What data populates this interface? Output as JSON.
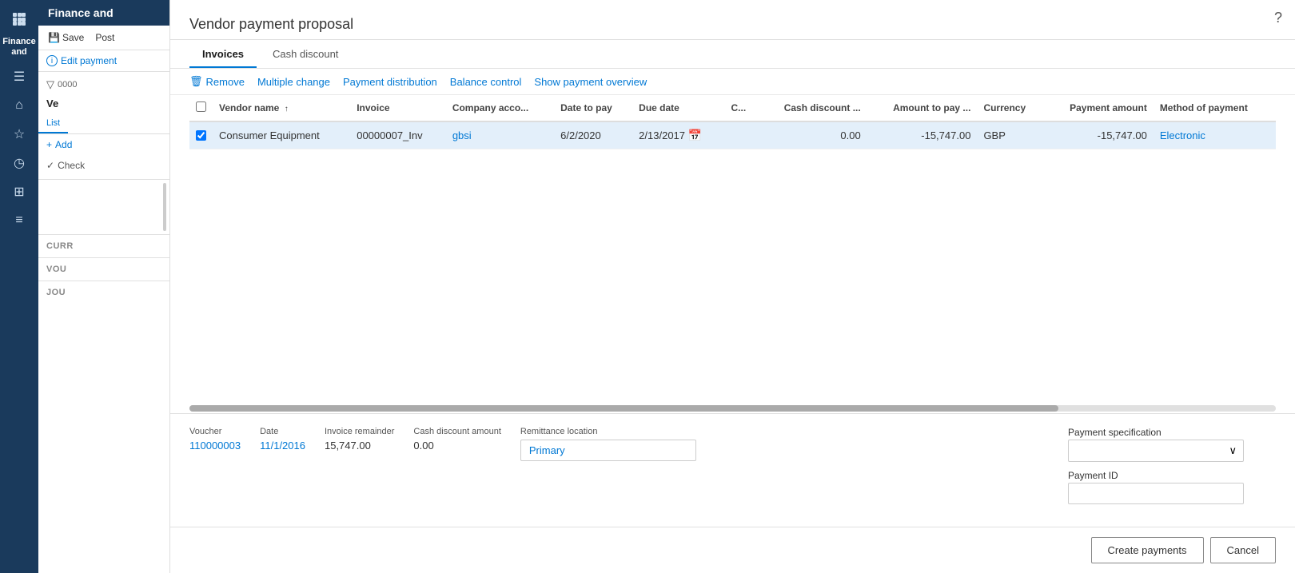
{
  "sidebar": {
    "header": "Finance and",
    "save_button": "Save",
    "post_button": "Post",
    "edit_payment": "Edit payment",
    "filter_label": "List",
    "entry_id": "0000",
    "entry_title": "Ve",
    "tabs": [
      "List"
    ],
    "add_label": "Add",
    "check_label": "Check",
    "labels": {
      "curr": "CURR",
      "curr_value": "",
      "vouch": "VOU",
      "vouch_value": "",
      "jour": "JOU",
      "jour_value": ""
    }
  },
  "dialog": {
    "title": "Vendor payment proposal",
    "tabs": [
      "Invoices",
      "Cash discount"
    ],
    "active_tab": "Invoices",
    "toolbar": {
      "remove": "Remove",
      "multiple_change": "Multiple change",
      "payment_distribution": "Payment distribution",
      "balance_control": "Balance control",
      "show_payment_overview": "Show payment overview"
    },
    "table": {
      "columns": [
        {
          "id": "checkbox",
          "label": ""
        },
        {
          "id": "vendor_name",
          "label": "Vendor name"
        },
        {
          "id": "invoice",
          "label": "Invoice"
        },
        {
          "id": "company_account",
          "label": "Company acco..."
        },
        {
          "id": "date_to_pay",
          "label": "Date to pay"
        },
        {
          "id": "due_date",
          "label": "Due date"
        },
        {
          "id": "c",
          "label": "C..."
        },
        {
          "id": "cash_discount",
          "label": "Cash discount ..."
        },
        {
          "id": "amount_to_pay",
          "label": "Amount to pay ..."
        },
        {
          "id": "currency",
          "label": "Currency"
        },
        {
          "id": "payment_amount",
          "label": "Payment amount"
        },
        {
          "id": "method_of_payment",
          "label": "Method of payment"
        }
      ],
      "rows": [
        {
          "vendor_name": "Consumer Equipment",
          "invoice": "00000007_Inv",
          "company_account": "gbsi",
          "date_to_pay": "6/2/2020",
          "due_date": "2/13/2017",
          "c": "",
          "cash_discount": "0.00",
          "amount_to_pay": "-15,747.00",
          "currency": "GBP",
          "payment_amount": "-15,747.00",
          "method_of_payment": "Electronic",
          "selected": true
        }
      ]
    },
    "detail": {
      "voucher_label": "Voucher",
      "voucher_value": "110000003",
      "date_label": "Date",
      "date_value": "11/1/2016",
      "invoice_remainder_label": "Invoice remainder",
      "invoice_remainder_value": "15,747.00",
      "cash_discount_amount_label": "Cash discount amount",
      "cash_discount_amount_value": "0.00",
      "remittance_location_label": "Remittance location",
      "remittance_location_value": "Primary",
      "payment_specification_label": "Payment specification",
      "payment_specification_value": "",
      "payment_id_label": "Payment ID",
      "payment_id_value": ""
    },
    "footer": {
      "create_payments": "Create payments",
      "cancel": "Cancel"
    }
  },
  "help_icon": "?"
}
